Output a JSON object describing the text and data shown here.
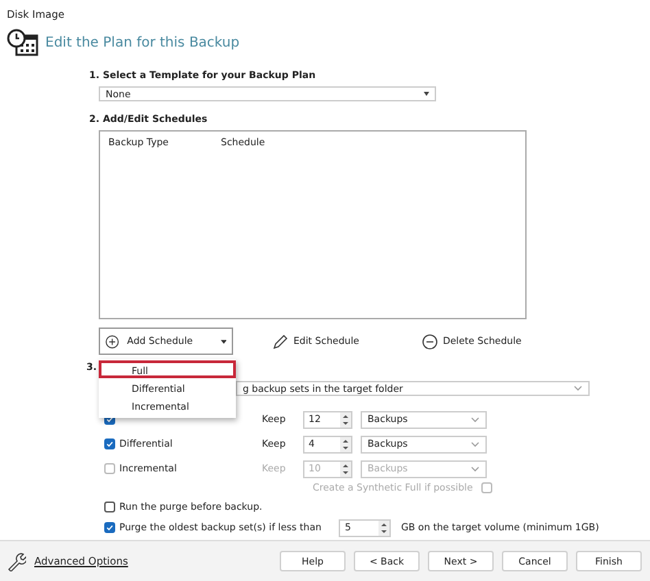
{
  "window": {
    "title": "Disk Image"
  },
  "header": {
    "title": "Edit the Plan for this Backup"
  },
  "template": {
    "heading": "1. Select a Template for your Backup Plan",
    "value": "None"
  },
  "schedules": {
    "heading": "2. Add/Edit Schedules",
    "columns": [
      "Backup Type",
      "Schedule"
    ]
  },
  "schedule_buttons": [
    {
      "kind": "add",
      "label": "Add Schedule"
    },
    {
      "kind": "edit",
      "label": "Edit Schedule"
    },
    {
      "kind": "delete",
      "label": "Delete Schedule"
    }
  ],
  "add_menu": [
    {
      "label": "Full",
      "selected": true
    },
    {
      "label": "Differential",
      "selected": false
    },
    {
      "label": "Incremental",
      "selected": false
    }
  ],
  "retention": {
    "heading": "3.",
    "policy": "g backup sets in the target folder",
    "rows": [
      {
        "checked": true,
        "keep": "Keep",
        "count": "12",
        "unit": "Backups",
        "disabled": false
      },
      {
        "label": "Differential",
        "checked": true,
        "keep": "Keep",
        "count": "4",
        "unit": "Backups",
        "disabled": false
      },
      {
        "label": "Incremental",
        "checked": false,
        "keep": "Keep",
        "count": "10",
        "unit": "Backups",
        "disabled": true
      }
    ],
    "synthetic": {
      "label": "Create a Synthetic Full if possible",
      "checked": false,
      "disabled": true
    }
  },
  "options": [
    {
      "kind": "plain",
      "label": "Run the purge before backup.",
      "checked": false
    },
    {
      "kind": "threshold",
      "label": "Purge the oldest backup set(s) if less than",
      "checked": true,
      "value": "5",
      "suffix": "GB on the target volume (minimum 1GB)"
    }
  ],
  "footer": {
    "link": "Advanced Options",
    "buttons": [
      "Help",
      "< Back",
      "Next >",
      "Cancel",
      "Finish"
    ]
  }
}
